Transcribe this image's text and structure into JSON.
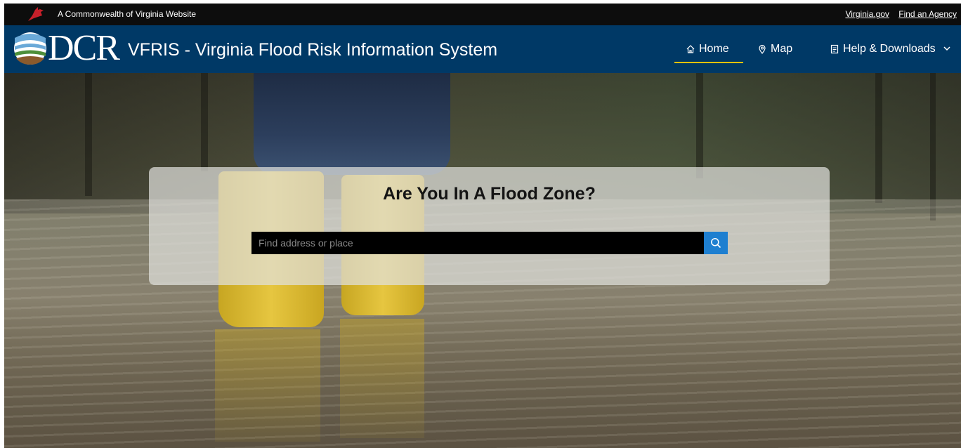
{
  "commonwealth_bar": {
    "text": "A Commonwealth of Virginia Website",
    "links": [
      "Virginia.gov",
      "Find an Agency"
    ],
    "logo_icon": "cardinal-icon"
  },
  "header": {
    "logo_word": "DCR",
    "title": "VFRIS - Virginia Flood Risk Information System",
    "nav": {
      "home": "Home",
      "map": "Map",
      "help": "Help & Downloads"
    },
    "accent_color": "#f2c200",
    "background_color": "#003966"
  },
  "search": {
    "heading": "Are You In A Flood Zone?",
    "placeholder": "Find address or place",
    "button_icon": "search-icon",
    "button_color": "#1e7fd0"
  }
}
